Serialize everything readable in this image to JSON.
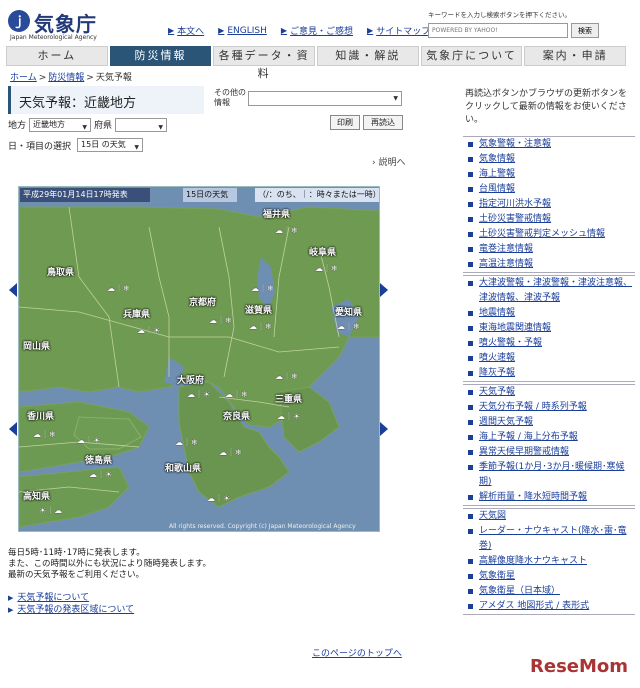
{
  "header": {
    "logo_text": "気象庁",
    "logo_sub": "Japan Meteorological Agency",
    "links": [
      "本文へ",
      "ENGLISH",
      "ご意見・ご感想",
      "サイトマップ"
    ],
    "search_hint": "キーワードを入力し検索ボタンを押下ください。",
    "search_placeholder": "POWERED BY YAHOO!",
    "search_button": "検索"
  },
  "nav": {
    "tabs": [
      "ホーム",
      "防災情報",
      "各種データ・資料",
      "知識・解説",
      "気象庁について",
      "案内・申請"
    ],
    "active_index": 1
  },
  "breadcrumb": [
    "ホーム",
    "防災情報",
    "天気予報"
  ],
  "page": {
    "title": "天気予報：近畿地方",
    "other_info_label": "その他の情報",
    "region_label": "地方",
    "region_value": "近畿地方",
    "prefecture_label": "府県",
    "print_button": "印刷",
    "reload_button": "再読込",
    "day_item_label": "日・項目の選択",
    "day_item_value": "15日 の天気",
    "explain_link": "説明へ"
  },
  "map": {
    "header_time": "平成29年01月14日17時発表",
    "header_day": "15日の天気",
    "header_legend": "（/：のち、｜：時々または一時）",
    "prefectures": [
      "福井県",
      "岐阜県",
      "鳥取県",
      "兵庫県",
      "京都府",
      "滋賀県",
      "愛知県",
      "岡山県",
      "大阪府",
      "三重県",
      "奈良県",
      "香川県",
      "徳島県",
      "和歌山県",
      "高知県"
    ],
    "copyright": "All rights reserved. Copyright (c) Japan Meteorological Agency"
  },
  "notes": [
    "毎日5時･11時･17時に発表します。",
    "また、この時間以外にも状況により随時発表します。",
    "最新の天気予報をご利用ください。"
  ],
  "bottom_links": [
    "天気予報について",
    "天気予報の発表区域について"
  ],
  "page_top": "このページのトップへ",
  "sidebar": {
    "hint": "再読込ボタンかブラウザの更新ボタンをクリックして最新の情報をお使いください。",
    "groups": [
      [
        "気象警報・注意報",
        "気象情報",
        "海上警報",
        "台風情報",
        "指定河川洪水予報",
        "土砂災害警戒情報",
        "土砂災害警戒判定メッシュ情報",
        "竜巻注意情報",
        "高温注意情報"
      ],
      [
        "大津波警報・津波警報・津波注意報、津波情報、津波予報",
        "地震情報",
        "東海地震関連情報",
        "噴火警報・予報",
        "噴火速報",
        "降灰予報"
      ],
      [
        "天気予報",
        "天気分布予報 / 時系列予報",
        "週間天気予報",
        "海上予報 / 海上分布予報",
        "異常天候早期警戒情報",
        "季節予報(1か月･3か月･暖候期･寒候期)",
        "解析雨量・降水短時間予報"
      ],
      [
        "天気図",
        "レーダー・ナウキャスト(降水･雷･竜巻)",
        "高解像度降水ナウキャスト",
        "気象衛星",
        "気象衛星（日本域）",
        "アメダス 地図形式 / 表形式"
      ]
    ]
  },
  "watermark": "ReseMom"
}
